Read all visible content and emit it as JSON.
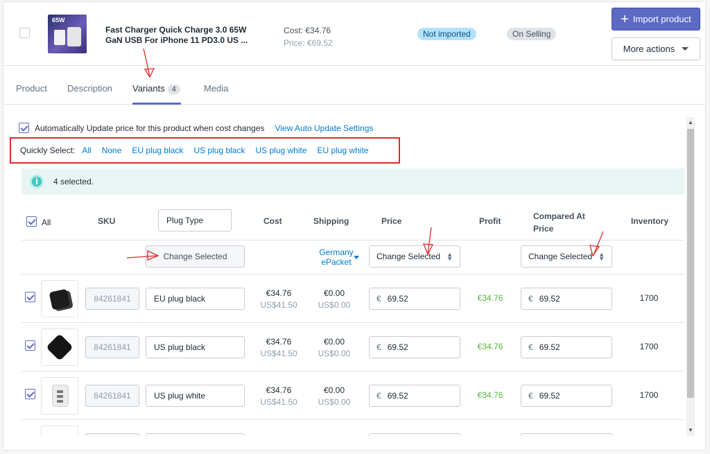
{
  "product": {
    "title": "Fast Charger Quick Charge 3.0 65W GaN USB For iPhone 11 PD3.0 US ...",
    "thumb_text": "65W",
    "cost": "Cost: €34.76",
    "price": "Price: €69.52",
    "import_status": "Not imported",
    "selling_status": "On Selling",
    "import_button": "Import product",
    "more_button": "More actions"
  },
  "tabs": [
    {
      "label": "Product"
    },
    {
      "label": "Description"
    },
    {
      "label": "Variants",
      "count": "4"
    },
    {
      "label": "Media"
    }
  ],
  "auto_update": {
    "label": "Automatically Update price for this product when cost changes",
    "link": "View Auto Update Settings"
  },
  "quick_select": {
    "label": "Quickly Select:",
    "options": [
      "All",
      "None",
      "EU plug black",
      "US plug black",
      "US plug white",
      "EU plug white"
    ]
  },
  "selection_info": "4 selected.",
  "table": {
    "headers": {
      "all": "All",
      "sku": "SKU",
      "plug_type": "Plug Type",
      "cost": "Cost",
      "shipping": "Shipping",
      "price": "Price",
      "profit": "Profit",
      "compared": "Compared At Price",
      "inventory": "Inventory"
    },
    "bulk": {
      "change_selected": "Change Selected",
      "shipping_method": "Germany ePacket"
    },
    "rows": [
      {
        "sku": "84261841",
        "variant": "EU plug black",
        "cost": "€34.76",
        "cost_usd": "US$41.50",
        "ship": "€0.00",
        "ship_usd": "US$0.00",
        "currency": "€",
        "price": "69.52",
        "profit": "€34.76",
        "compared": "69.52",
        "inventory": "1700"
      },
      {
        "sku": "84261841",
        "variant": "US plug black",
        "cost": "€34.76",
        "cost_usd": "US$41.50",
        "ship": "€0.00",
        "ship_usd": "US$0.00",
        "currency": "€",
        "price": "69.52",
        "profit": "€34.76",
        "compared": "69.52",
        "inventory": "1700"
      },
      {
        "sku": "84261841",
        "variant": "US plug white",
        "cost": "€34.76",
        "cost_usd": "US$41.50",
        "ship": "€0.00",
        "ship_usd": "US$0.00",
        "currency": "€",
        "price": "69.52",
        "profit": "€34.76",
        "compared": "69.52",
        "inventory": "1700"
      }
    ]
  },
  "colors": {
    "primary": "#5c6ac4",
    "link": "#007ace",
    "profit": "#50b83c",
    "annotation": "#d82c2c"
  }
}
